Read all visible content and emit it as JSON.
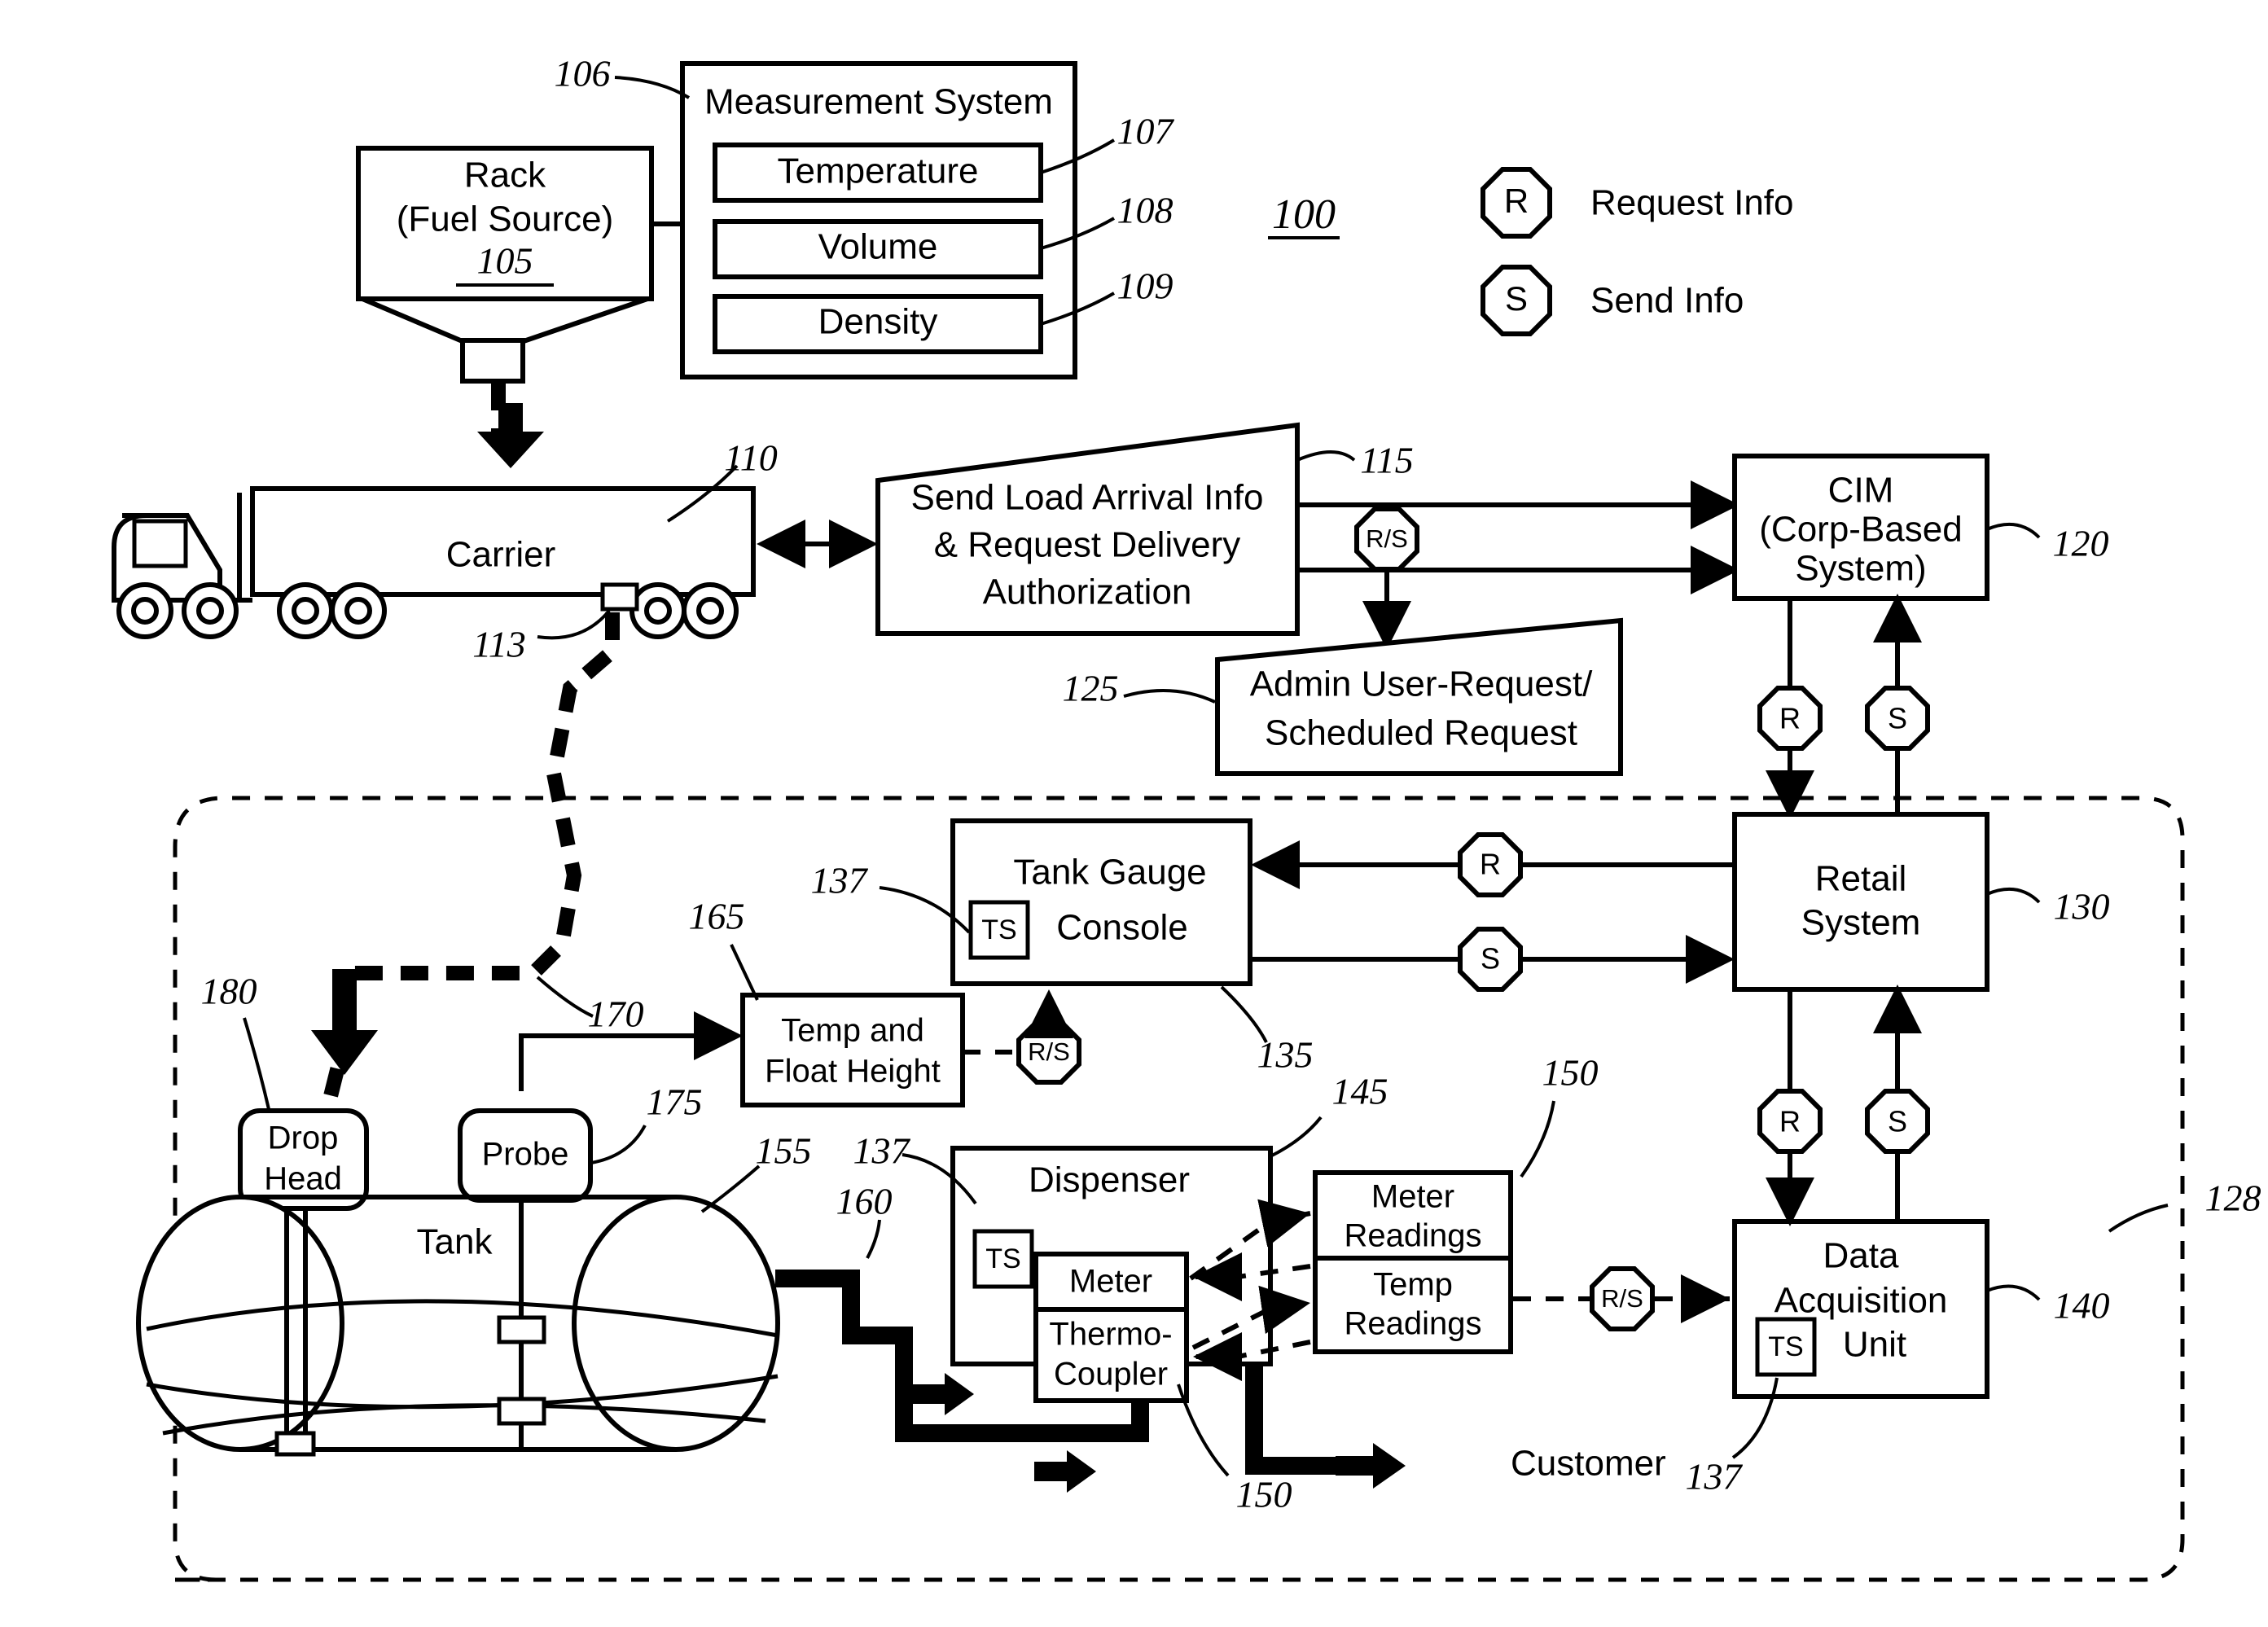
{
  "figure": {
    "system_ref": "100",
    "legend": [
      {
        "symbol": "R",
        "label": "Request Info"
      },
      {
        "symbol": "S",
        "label": "Send Info"
      }
    ]
  },
  "blocks": {
    "rack": {
      "line1": "Rack",
      "line2": "(Fuel Source)",
      "ref": "105"
    },
    "measurement_system": {
      "title": "Measurement System",
      "ref": "106",
      "items": [
        {
          "label": "Temperature",
          "ref": "107"
        },
        {
          "label": "Volume",
          "ref": "108"
        },
        {
          "label": "Density",
          "ref": "109"
        }
      ]
    },
    "carrier": {
      "label": "Carrier",
      "ref": "110",
      "valve_ref": "113"
    },
    "send_load": {
      "line1": "Send Load Arrival Info",
      "line2": "& Request Delivery",
      "line3": "Authorization",
      "ref": "115"
    },
    "admin_request": {
      "line1": "Admin User-Request/",
      "line2": "Scheduled Request",
      "ref": "125"
    },
    "cim": {
      "line1": "CIM",
      "line2": "(Corp-Based",
      "line3": "System)",
      "ref": "120"
    },
    "retail_system": {
      "line1": "Retail",
      "line2": "System",
      "ref": "130"
    },
    "tank_gauge_console": {
      "line1": "Tank Gauge",
      "line2": "Console",
      "ref": "135",
      "ts": "TS",
      "ts_ref": "137"
    },
    "temp_float": {
      "line1": "Temp and",
      "line2": "Float Height",
      "ref": "165"
    },
    "probe": {
      "label": "Probe",
      "ref": "175"
    },
    "drop_head": {
      "line1": "Drop",
      "line2": "Head",
      "ref": "180"
    },
    "tank": {
      "label": "Tank",
      "ref": "155"
    },
    "fuel_line": {
      "ref": "160"
    },
    "delivery_hose": {
      "ref": "170"
    },
    "dispenser": {
      "label": "Dispenser",
      "ref": "145",
      "ts": "TS",
      "ts_ref": "137"
    },
    "meter": {
      "label": "Meter"
    },
    "thermo_coupler": {
      "line1": "Thermo-",
      "line2": "Coupler",
      "ref": "150"
    },
    "meter_readings": {
      "line1": "Meter",
      "line2": "Readings",
      "ref": "150"
    },
    "temp_readings": {
      "line1": "Temp",
      "line2": "Readings"
    },
    "data_acquisition_unit": {
      "line1": "Data",
      "line2": "Acquisition",
      "line3": "Unit",
      "ref": "140",
      "ts": "TS",
      "ts_ref": "137"
    },
    "customer": {
      "label": "Customer"
    },
    "site_boundary": {
      "ref": "128"
    }
  },
  "connectors": {
    "rs_load_cim": "R/S",
    "r_cim_retail": "R",
    "s_retail_cim": "S",
    "r_retail_console": "R",
    "s_console_retail": "S",
    "rs_temp_float_console": "R/S",
    "r_retail_dau": "R",
    "s_dau_retail": "S",
    "rs_readings_dau": "R/S"
  }
}
